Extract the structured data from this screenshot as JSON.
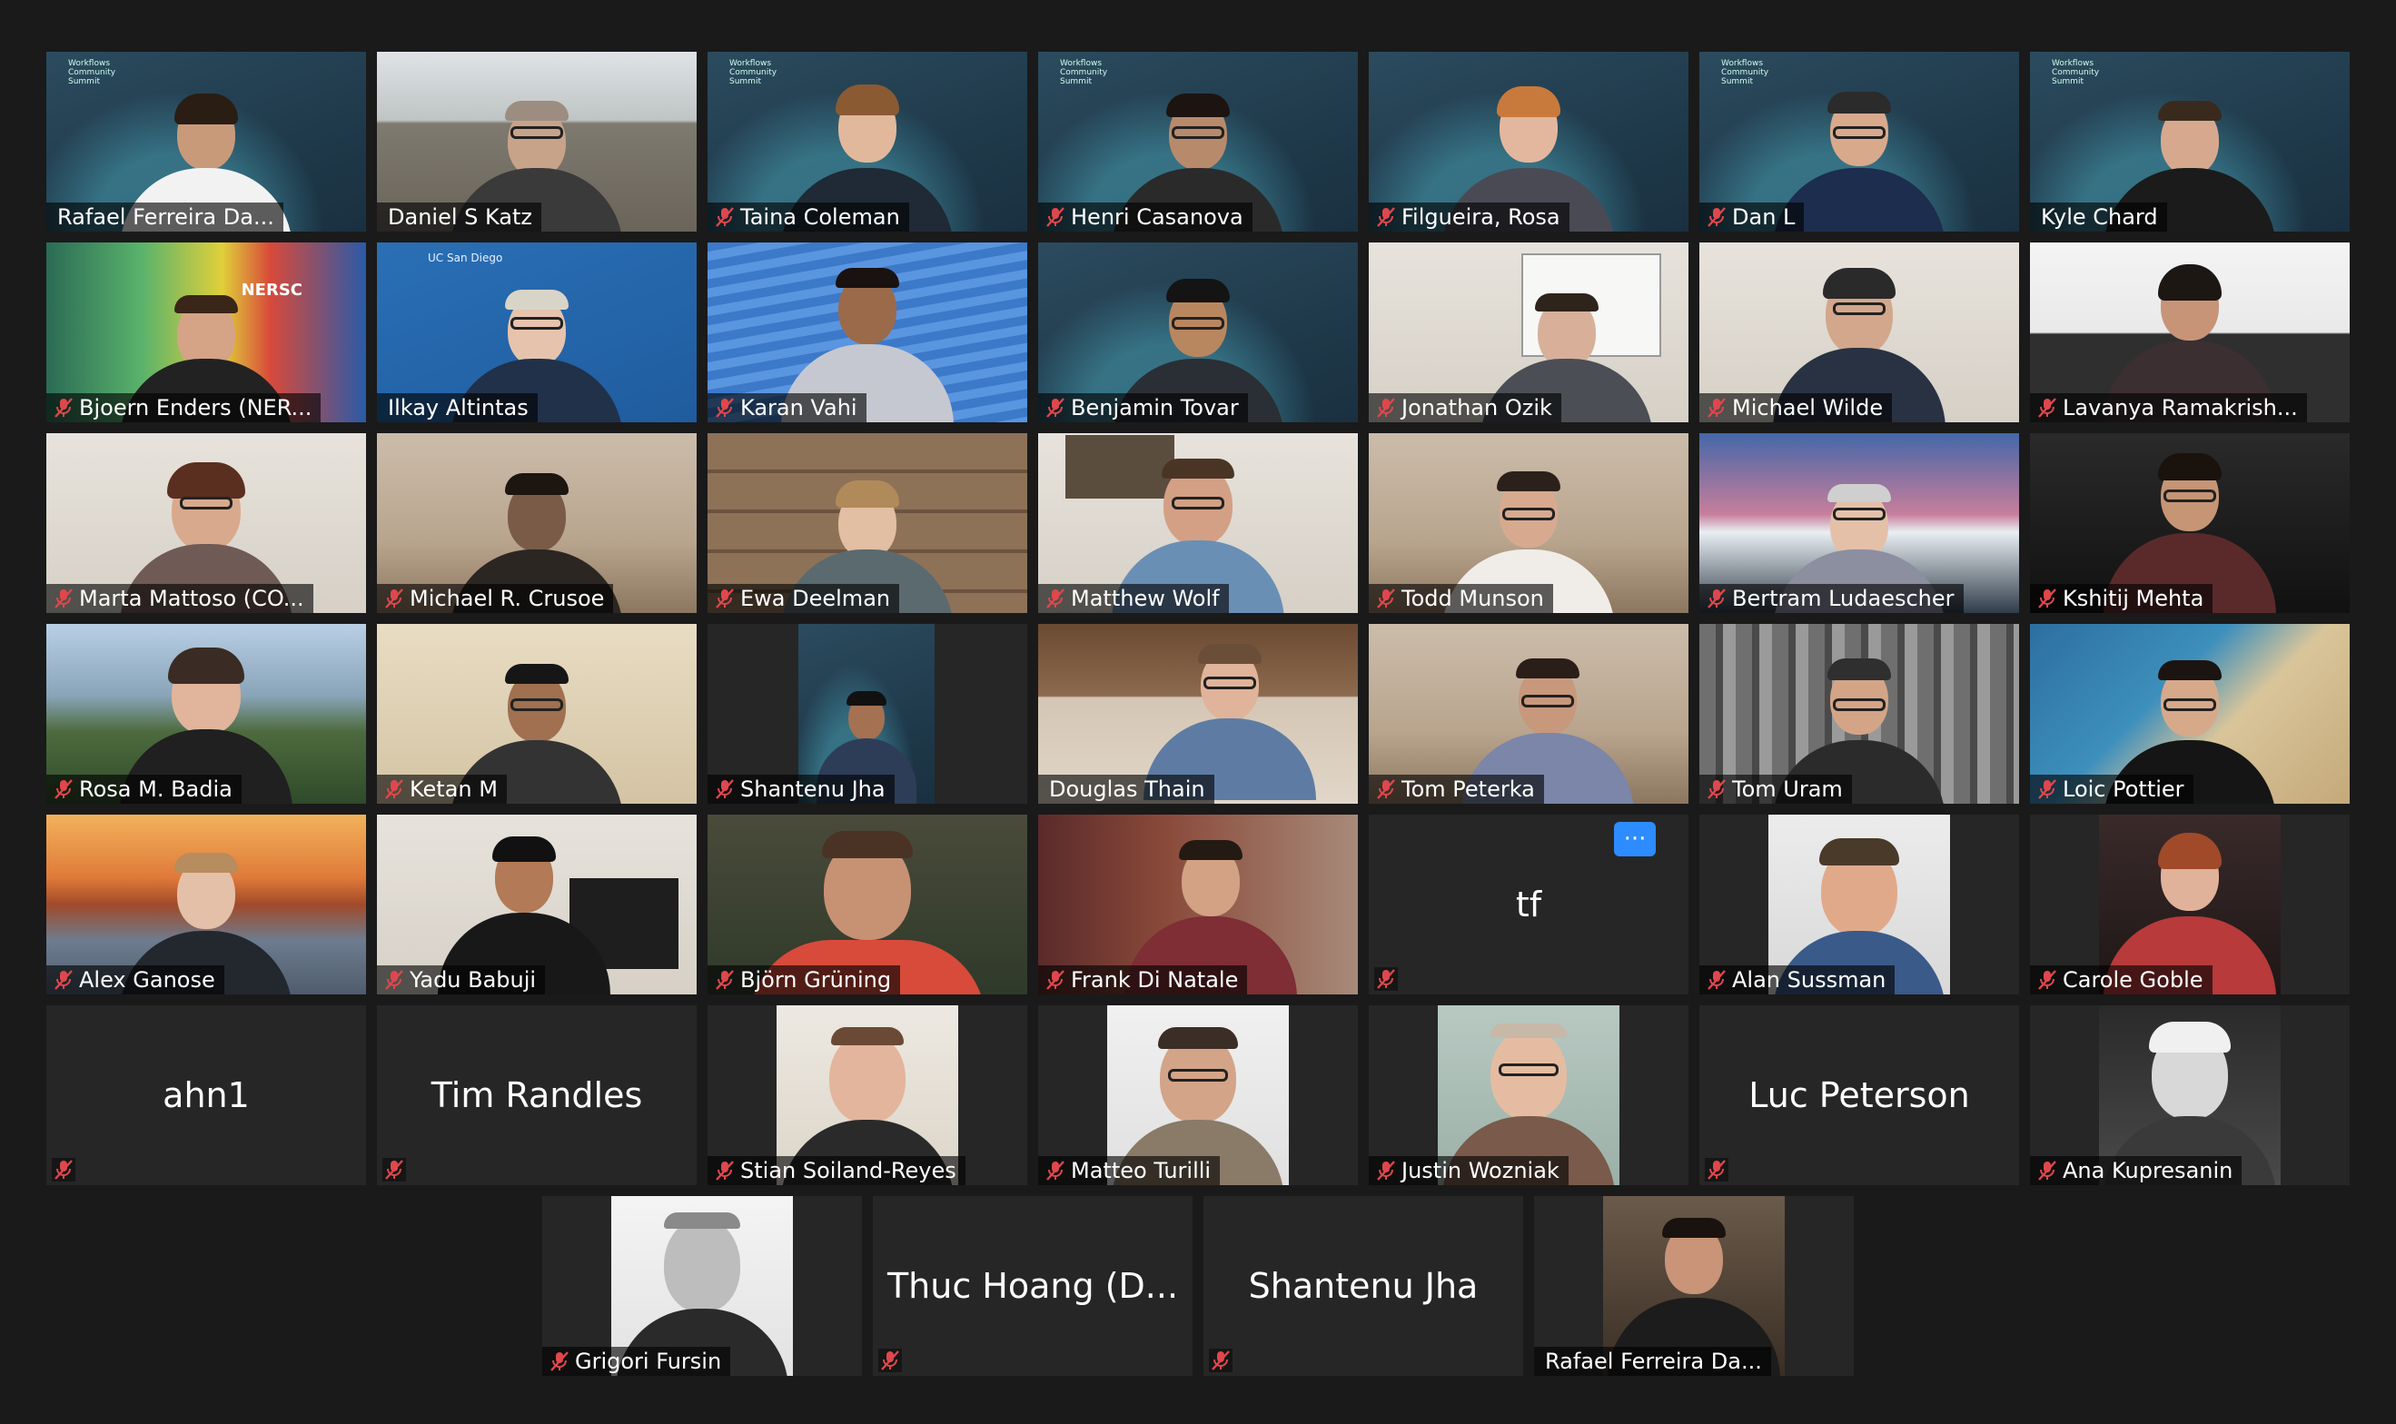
{
  "colors": {
    "background": "#1a1a1a",
    "tile_background": "#262626",
    "active_speaker_border": "#e8e48f",
    "mute_icon": "#e0474c",
    "more_button": "#2d8cff"
  },
  "icons": {
    "muted_mic": "mic-muted-icon",
    "more_options": "ellipsis-icon"
  },
  "rows": [
    [
      {
        "name": "Rafael Ferreira Da...",
        "muted": false,
        "active": true
      },
      {
        "name": "Daniel S Katz",
        "muted": false
      },
      {
        "name": "Taina Coleman",
        "muted": true
      },
      {
        "name": "Henri Casanova",
        "muted": true
      },
      {
        "name": "Filgueira, Rosa",
        "muted": true
      },
      {
        "name": "Dan L",
        "muted": true
      },
      {
        "name": "Kyle Chard",
        "muted": false
      }
    ],
    [
      {
        "name": "Bjoern Enders (NER...",
        "muted": true,
        "backdrop_text": "NERSC"
      },
      {
        "name": "Ilkay Altintas",
        "muted": false,
        "backdrop_text": "UC San Diego"
      },
      {
        "name": "Karan Vahi",
        "muted": true
      },
      {
        "name": "Benjamin Tovar",
        "muted": true
      },
      {
        "name": "Jonathan Ozik",
        "muted": true
      },
      {
        "name": "Michael Wilde",
        "muted": true
      },
      {
        "name": "Lavanya Ramakrish...",
        "muted": true
      }
    ],
    [
      {
        "name": "Marta Mattoso (CO...",
        "muted": true
      },
      {
        "name": "Michael R. Crusoe",
        "muted": true
      },
      {
        "name": "Ewa Deelman",
        "muted": true
      },
      {
        "name": "Matthew Wolf",
        "muted": true
      },
      {
        "name": "Todd Munson",
        "muted": true
      },
      {
        "name": "Bertram Ludaescher",
        "muted": true
      },
      {
        "name": "Kshitij Mehta",
        "muted": true
      }
    ],
    [
      {
        "name": "Rosa M. Badia",
        "muted": true
      },
      {
        "name": "Ketan M",
        "muted": true
      },
      {
        "name": "Shantenu Jha",
        "muted": true
      },
      {
        "name": "Douglas Thain",
        "muted": false
      },
      {
        "name": "Tom Peterka",
        "muted": true
      },
      {
        "name": "Tom Uram",
        "muted": true
      },
      {
        "name": "Loic Pottier",
        "muted": true
      }
    ],
    [
      {
        "name": "Alex Ganose",
        "muted": true
      },
      {
        "name": "Yadu Babuji",
        "muted": true
      },
      {
        "name": "Björn Grüning",
        "muted": true
      },
      {
        "name": "Frank Di Natale",
        "muted": true
      },
      {
        "name": "tf",
        "muted": true,
        "video_off": true,
        "more_button": "···"
      },
      {
        "name": "Alan Sussman",
        "muted": true
      },
      {
        "name": "Carole Goble",
        "muted": true
      }
    ],
    [
      {
        "name": "ahn1",
        "muted": true,
        "video_off": true
      },
      {
        "name": "Tim Randles",
        "muted": true,
        "video_off": true
      },
      {
        "name": "Stian Soiland-Reyes",
        "muted": true
      },
      {
        "name": "Matteo Turilli",
        "muted": true
      },
      {
        "name": "Justin Wozniak",
        "muted": true
      },
      {
        "name": "Luc Peterson",
        "muted": true,
        "video_off": true
      },
      {
        "name": "Ana Kupresanin",
        "muted": true
      }
    ],
    [
      {
        "name": "Grigori Fursin",
        "muted": true
      },
      {
        "name": "Thuc Hoang (D...",
        "muted": true,
        "video_off": true
      },
      {
        "name": "Shantenu Jha",
        "muted": true,
        "video_off": true
      },
      {
        "name": "Rafael Ferreira Da...",
        "muted": false
      }
    ]
  ]
}
